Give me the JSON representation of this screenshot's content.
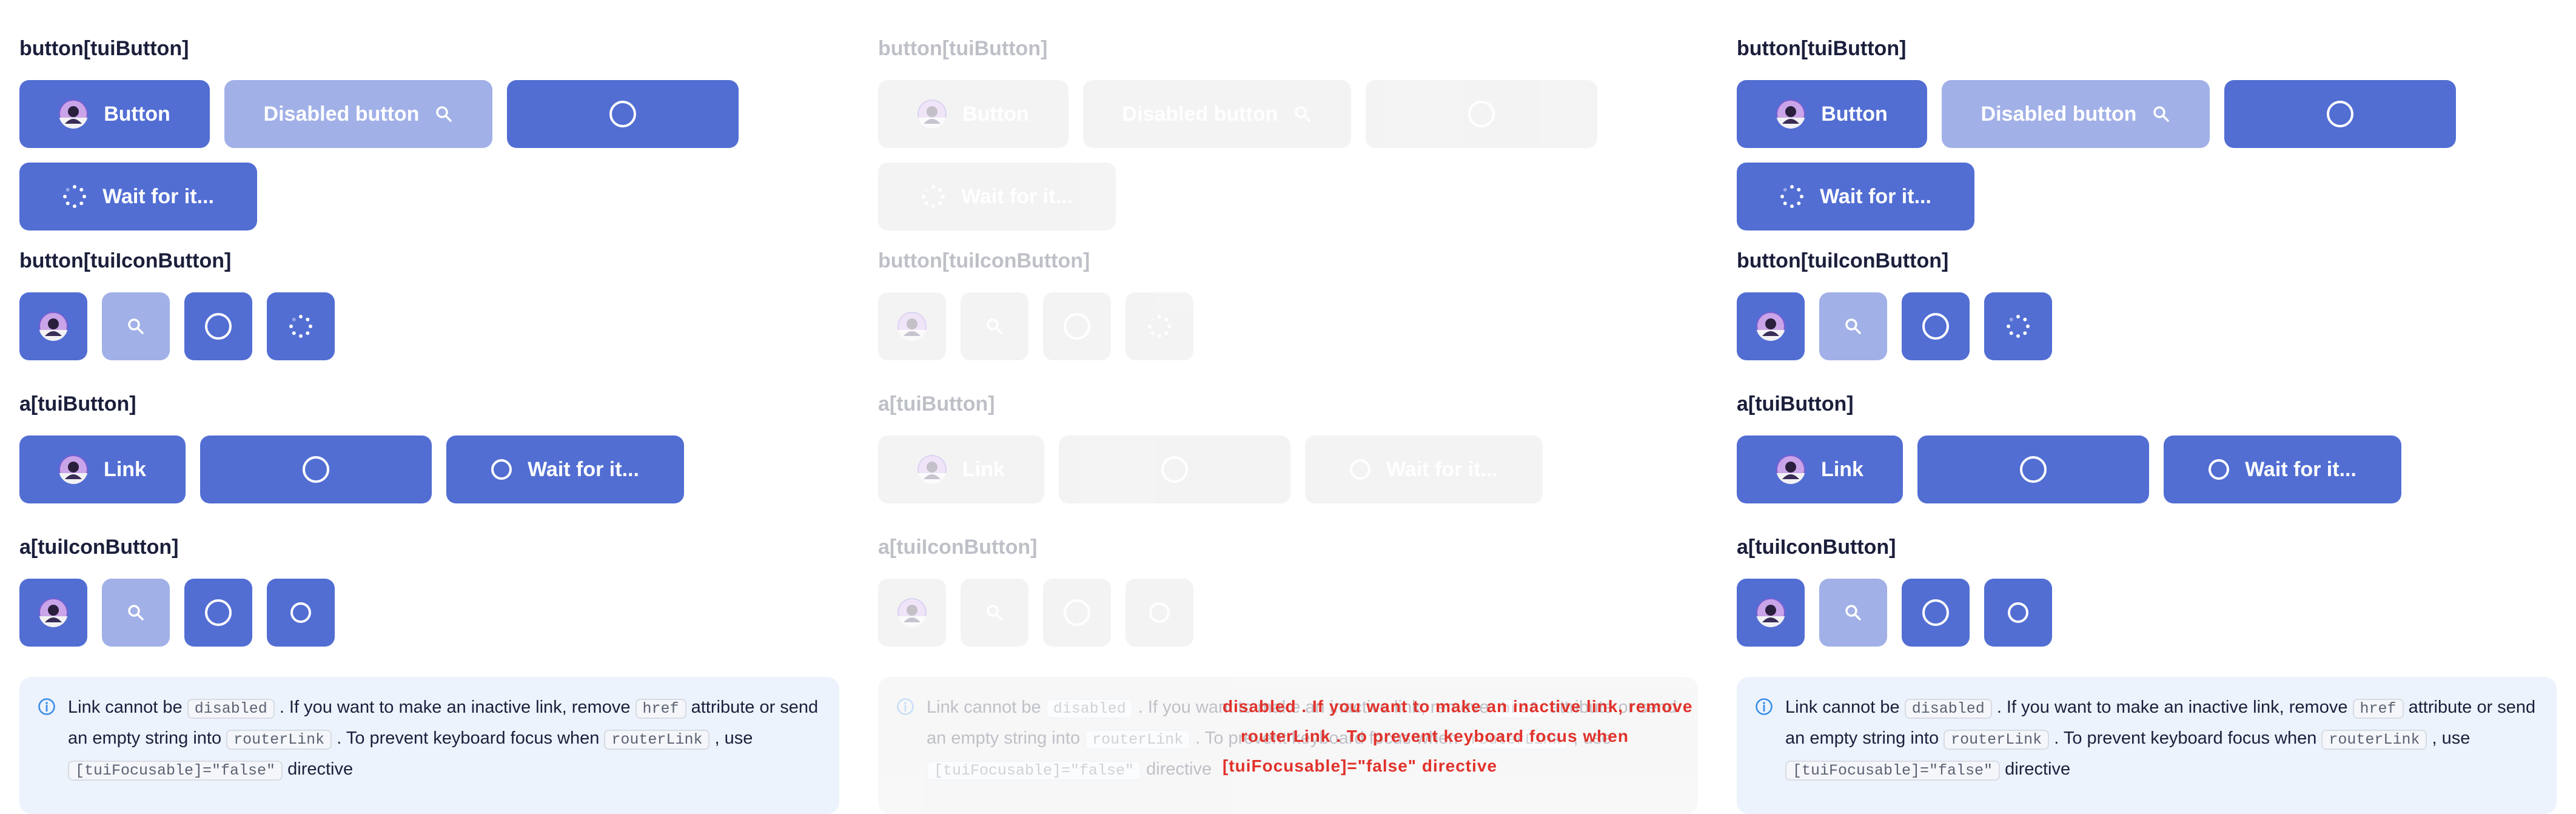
{
  "sections": {
    "button_tuiButton": "button[tuiButton]",
    "button_tuiIconButton": "button[tuiIconButton]",
    "a_tuiButton": "a[tuiButton]",
    "a_tuiIconButton": "a[tuiIconButton]"
  },
  "buttons": {
    "button": "Button",
    "disabled": "Disabled button",
    "wait": "Wait for it...",
    "link": "Link"
  },
  "note": {
    "t1": "Link cannot be",
    "c1": "disabled",
    "t2": ". If you want to make an inactive link, remove",
    "c2": "href",
    "t3": "attribute or send an empty string into",
    "c3": "routerLink",
    "t4": ". To prevent keyboard focus when",
    "c4": "routerLink",
    "t5": ", use",
    "c5": "[tuiFocusable]=\"false\"",
    "t6": "directive"
  },
  "colors": {
    "primary": "#526ed3",
    "primary_disabled": "#a1b0e7",
    "note_bg": "#ecf3fd",
    "info_icon": "#3d8ee6",
    "diff_text": "#e1322b",
    "heading": "#1b1f3b"
  },
  "icons": [
    "avatar-icon",
    "search-icon",
    "ring-icon",
    "spinner-icon",
    "info-icon"
  ]
}
